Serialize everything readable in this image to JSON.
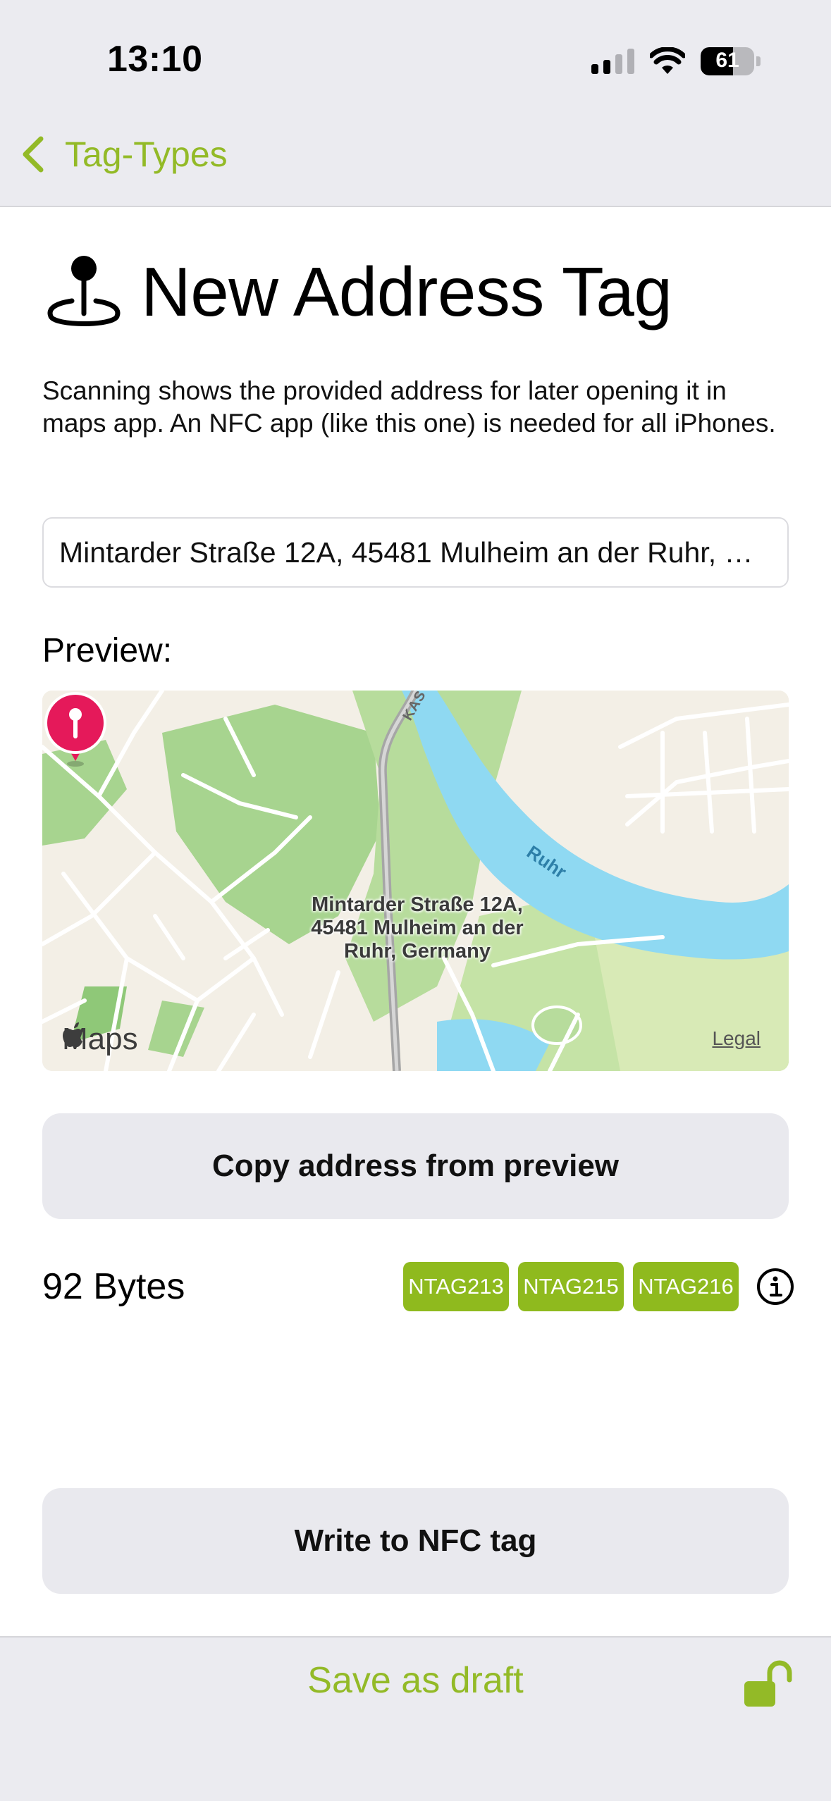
{
  "status_bar": {
    "time": "13:10",
    "battery": "61",
    "battery_level": 0.61
  },
  "nav": {
    "back_label": "Tag-Types",
    "back_icon": "chevron-left-icon"
  },
  "header": {
    "title": "New Address Tag",
    "icon": "map-pin-icon"
  },
  "description": "Scanning shows the provided address for later opening it in maps app. An NFC app (like this one) is needed for all iPhones.",
  "address_field": {
    "value": "Mintarder Straße 12A, 45481 Mulheim an der Ruhr, Germany"
  },
  "preview": {
    "label": "Preview:",
    "map": {
      "pin_label": "Mintarder Straße 12A, 45481 Mulheim an der Ruhr, Germany",
      "river_label": "Ruhr",
      "road_label": "KAS",
      "logo_text": "Maps",
      "legal_label": "Legal"
    }
  },
  "actions": {
    "copy_label": "Copy address from preview",
    "write_label": "Write to NFC tag"
  },
  "size": {
    "bytes_label": "92 Bytes",
    "chips": [
      "NTAG213",
      "NTAG215",
      "NTAG216"
    ],
    "info_icon": "info-icon"
  },
  "footer": {
    "save_label": "Save as draft",
    "lock_icon": "unlocked-padlock-icon"
  },
  "colors": {
    "accent": "#93ba27",
    "chip": "#8fba1e",
    "pin": "#e5195a",
    "water": "#8fd9f2"
  }
}
